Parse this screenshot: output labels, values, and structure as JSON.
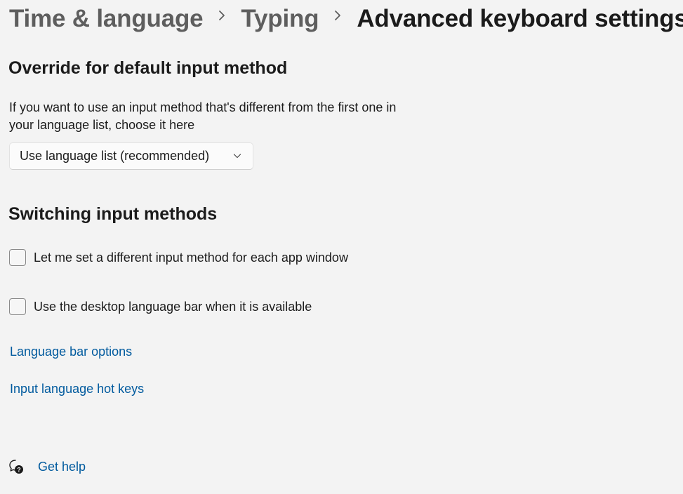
{
  "breadcrumb": {
    "items": [
      "Time & language",
      "Typing",
      "Advanced keyboard settings"
    ]
  },
  "override": {
    "title": "Override for default input method",
    "description": "If you want to use an input method that's different from the first one in your language list, choose it here",
    "dropdown_value": "Use language list (recommended)"
  },
  "switching": {
    "title": "Switching input methods",
    "checkbox_per_app_label": "Let me set a different input method for each app window",
    "checkbox_per_app_checked": false,
    "checkbox_language_bar_label": "Use the desktop language bar when it is available",
    "checkbox_language_bar_checked": false
  },
  "links": {
    "language_bar_options": "Language bar options",
    "input_language_hot_keys": "Input language hot keys"
  },
  "help": {
    "get_help_label": "Get help",
    "icon": "help-chat-icon"
  },
  "colors": {
    "background": "#f3f3f3",
    "link": "#005a9e",
    "breadcrumb_parent": "#5e5e5e"
  }
}
